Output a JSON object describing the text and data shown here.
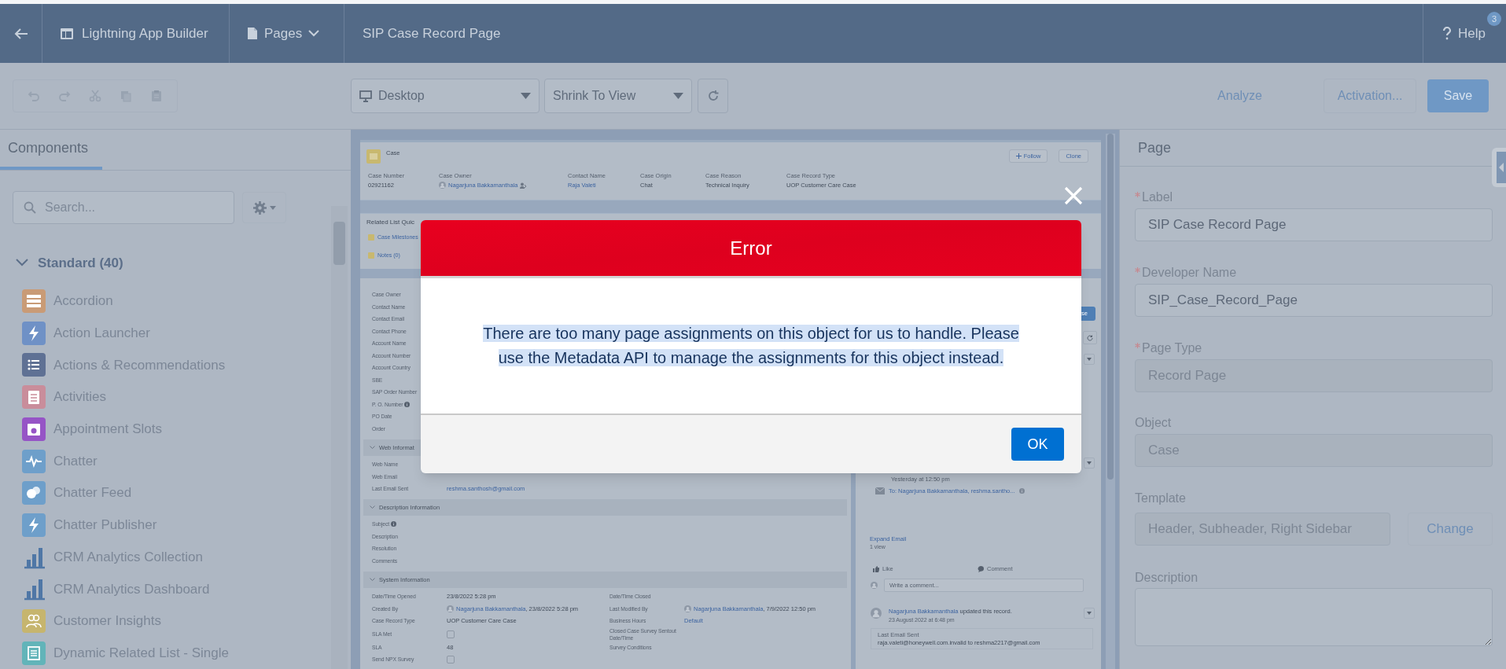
{
  "header": {
    "title": "Lightning App Builder",
    "pages": "Pages",
    "page_name": "SIP Case Record Page",
    "help": "Help",
    "help_badge": "3"
  },
  "toolbar": {
    "device": "Desktop",
    "view": "Shrink To View",
    "analyze": "Analyze",
    "activation": "Activation...",
    "save": "Save"
  },
  "components": {
    "tab": "Components",
    "search_placeholder": "Search...",
    "section": {
      "label": "Standard (40)",
      "expanded": true
    },
    "items": [
      {
        "label": "Accordion",
        "kind": "tile",
        "color": "#c99b76"
      },
      {
        "label": "Action Launcher",
        "kind": "tile",
        "color": "#6f91c6"
      },
      {
        "label": "Actions & Recommendations",
        "kind": "tile",
        "color": "#5f7194"
      },
      {
        "label": "Activities",
        "kind": "tile",
        "color": "#c98d9b"
      },
      {
        "label": "Appointment Slots",
        "kind": "tile",
        "color": "#9654c6"
      },
      {
        "label": "Chatter",
        "kind": "tile",
        "color": "#6e9fca"
      },
      {
        "label": "Chatter Feed",
        "kind": "tile",
        "color": "#6e9fca"
      },
      {
        "label": "Chatter Publisher",
        "kind": "tile",
        "color": "#6e9fca"
      },
      {
        "label": "CRM Analytics Collection",
        "kind": "chart",
        "color": "#4f77a6"
      },
      {
        "label": "CRM Analytics Dashboard",
        "kind": "chart",
        "color": "#4f77a6"
      },
      {
        "label": "Customer Insights",
        "kind": "tile",
        "color": "#c6b56e"
      },
      {
        "label": "Dynamic Related List - Single",
        "kind": "tile",
        "color": "#62b4b9"
      }
    ]
  },
  "canvas": {
    "record_header": {
      "object": "Case",
      "actions": [
        "Follow",
        "Clone"
      ],
      "fields": [
        {
          "label": "Case Number",
          "value": {
            "kind": "text",
            "text": "02921162"
          }
        },
        {
          "label": "Case Owner",
          "value": {
            "kind": "person",
            "text": "Nagarjuna Bakkamanthala",
            "change_icon": true
          }
        },
        {
          "label": "Contact Name",
          "value": {
            "kind": "link",
            "text": "Raja Valeti"
          }
        },
        {
          "label": "Case Origin",
          "value": {
            "kind": "text",
            "text": "Chat"
          }
        },
        {
          "label": "Case Reason",
          "value": {
            "kind": "text",
            "text": "Technical Inquiry"
          }
        },
        {
          "label": "Case Record Type",
          "value": {
            "kind": "text",
            "text": "UOP Customer Care Case"
          }
        }
      ]
    },
    "quick_links": {
      "title": "Related List Quic",
      "links": [
        "Case Milestones",
        "Notes (0)"
      ]
    },
    "details": [
      {
        "kind": "row",
        "cells": [
          {
            "label": "Case Owner"
          }
        ]
      },
      {
        "kind": "row",
        "cells": [
          {
            "label": "Contact Name"
          }
        ]
      },
      {
        "kind": "row",
        "cells": [
          {
            "label": "Contact Email"
          }
        ]
      },
      {
        "kind": "row",
        "cells": [
          {
            "label": "Contact Phone"
          }
        ]
      },
      {
        "kind": "row",
        "cells": [
          {
            "label": "Account Name"
          }
        ]
      },
      {
        "kind": "row",
        "cells": [
          {
            "label": "Account Number"
          }
        ]
      },
      {
        "kind": "row",
        "cells": [
          {
            "label": "Account Country"
          }
        ]
      },
      {
        "kind": "row",
        "cells": [
          {
            "label": "SBE"
          }
        ]
      },
      {
        "kind": "row",
        "cells": [
          {
            "label": "SAP Order Number"
          }
        ]
      },
      {
        "kind": "row",
        "cells": [
          {
            "label": "P. O. Number",
            "info": true
          }
        ]
      },
      {
        "kind": "row",
        "cells": [
          {
            "label": "PO Date"
          }
        ]
      },
      {
        "kind": "row",
        "cells": [
          {
            "label": "Order"
          }
        ]
      },
      {
        "kind": "section",
        "label": "Web Informat",
        "expanded": true
      },
      {
        "kind": "row",
        "cells": [
          {
            "label": "Web Name"
          }
        ]
      },
      {
        "kind": "row",
        "cells": [
          {
            "label": "Web Email"
          }
        ]
      },
      {
        "kind": "row",
        "cells": [
          {
            "label": "Last Email Sent",
            "value": {
              "kind": "link",
              "text": "reshma.santhosh@gmail.com"
            }
          }
        ]
      },
      {
        "kind": "section",
        "label": "Description Information",
        "expanded": true
      },
      {
        "kind": "row",
        "cells": [
          {
            "label": "Subject",
            "info": true
          }
        ]
      },
      {
        "kind": "row",
        "cells": [
          {
            "label": "Description"
          }
        ]
      },
      {
        "kind": "row",
        "cells": [
          {
            "label": "Resolution"
          }
        ]
      },
      {
        "kind": "row",
        "cells": [
          {
            "label": "Comments"
          }
        ]
      },
      {
        "kind": "section",
        "label": "System Information",
        "expanded": true
      },
      {
        "kind": "row",
        "cells": [
          {
            "label": "Date/Time Opened",
            "value": {
              "kind": "text",
              "text": "23/8/2022 5:28 pm"
            }
          },
          {
            "label": "Date/Time Closed"
          }
        ]
      },
      {
        "kind": "row",
        "cells": [
          {
            "label": "Created By",
            "value": {
              "kind": "person",
              "text": "Nagarjuna Bakkamanthala",
              "suffix": ", 23/8/2022 5:28 pm"
            }
          },
          {
            "label": "Last Modified By",
            "value": {
              "kind": "person",
              "text": "Nagarjuna Bakkamanthala",
              "suffix": ", 7/9/2022 12:50 pm"
            }
          }
        ]
      },
      {
        "kind": "row",
        "cells": [
          {
            "label": "Case Record Type",
            "value": {
              "kind": "text",
              "text": "UOP Customer Care Case"
            }
          },
          {
            "label": "Business Hours",
            "value": {
              "kind": "link",
              "text": "Default"
            }
          }
        ]
      },
      {
        "kind": "row",
        "cells": [
          {
            "label": "SLA Met",
            "value": {
              "kind": "checkbox",
              "checked": false
            }
          },
          {
            "label": "Closed Case Survey Sentout Date/Time"
          }
        ]
      },
      {
        "kind": "row",
        "cells": [
          {
            "label": "SLA",
            "value": {
              "kind": "text",
              "text": "48"
            }
          },
          {
            "label": "Survey Conditions"
          }
        ]
      },
      {
        "kind": "row",
        "cells": [
          {
            "label": "Send NPX Survey",
            "value": {
              "kind": "checkbox",
              "checked": false
            }
          }
        ]
      }
    ],
    "feed": {
      "button": "se",
      "time": "Yesterday at 12:50 pm",
      "recipients": "To: Nagarjuna Bakkamanthala, reshma.santho...",
      "expand": "Expand Email",
      "views": "1 view",
      "actions": [
        "Like",
        "Comment"
      ],
      "comment_placeholder": "Write a comment...",
      "post": {
        "author": "Nagarjuna Bakkamanthala",
        "action": " updated this record.",
        "time": "23 August 2022 at 6:48 pm",
        "detail_label": "Last Email Sent",
        "detail_value": "raja.valeti@honeywell.com.invalid to reshma2217@gmail.com"
      }
    }
  },
  "properties": {
    "title": "Page",
    "fields": [
      {
        "label": "Label",
        "required": true,
        "kind": "input",
        "value": "SIP Case Record Page",
        "disabled": false
      },
      {
        "label": "Developer Name",
        "required": true,
        "kind": "input",
        "value": "SIP_Case_Record_Page",
        "disabled": false
      },
      {
        "label": "Page Type",
        "required": true,
        "kind": "input",
        "value": "Record Page",
        "disabled": true
      },
      {
        "label": "Object",
        "required": false,
        "kind": "input",
        "value": "Case",
        "disabled": true
      },
      {
        "label": "Template",
        "required": false,
        "kind": "template",
        "value": "Header, Subheader, Right Sidebar",
        "disabled": true,
        "button": "Change"
      },
      {
        "label": "Description",
        "required": false,
        "kind": "textarea"
      }
    ]
  },
  "dialog": {
    "title": "Error",
    "message": "There are too many page assignments on this object for us to handle. Please use the Metadata API to manage the assignments for this object instead.",
    "highlighted": true,
    "ok": "OK"
  }
}
